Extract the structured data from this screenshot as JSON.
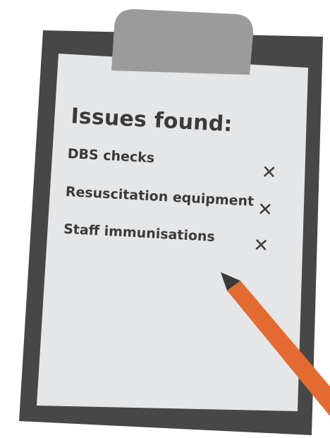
{
  "title": "Issues found:",
  "issues": [
    {
      "label": "DBS checks",
      "status": "✕"
    },
    {
      "label": "Resuscitation equipment",
      "status": "✕"
    },
    {
      "label": "Staff immunisations",
      "status": "✕"
    }
  ],
  "colors": {
    "board": "#474747",
    "paper": "#e5e6e8",
    "clip": "#9b9b9b",
    "pencil": "#e36b32",
    "pencil_tip": "#3a3a3a",
    "text": "#3a3a3a"
  }
}
